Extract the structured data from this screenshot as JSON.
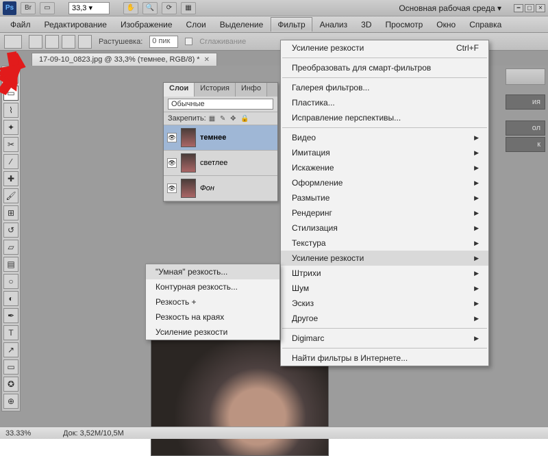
{
  "topbar": {
    "logo_text": "Ps",
    "zoom_value": "33,3 ▾",
    "workspace_label": "Основная рабочая среда ▾"
  },
  "menubar": {
    "items": [
      "Файл",
      "Редактирование",
      "Изображение",
      "Слои",
      "Выделение",
      "Фильтр",
      "Анализ",
      "3D",
      "Просмотр",
      "Окно",
      "Справка"
    ],
    "active_index": 5
  },
  "optbar": {
    "feather_label": "Растушевка:",
    "feather_value": "0 пик",
    "antialias_label": "Сглаживание"
  },
  "doc_tab": {
    "title": "17-09-10_0823.jpg @ 33,3% (темнее, RGB/8) *"
  },
  "layers": {
    "tabs": [
      "Слои",
      "История",
      "Инфо"
    ],
    "blend_label": "Обычные",
    "lock_label": "Закрепить:",
    "items": [
      {
        "name": "темнее",
        "bold": true
      },
      {
        "name": "светлее",
        "bold": false
      },
      {
        "name": "Фон",
        "italic": true
      }
    ]
  },
  "filter_menu": {
    "top": {
      "label": "Усиление резкости",
      "hotkey": "Ctrl+F"
    },
    "smart": "Преобразовать для смарт-фильтров",
    "gallery": "Галерея фильтров...",
    "liquify": "Пластика...",
    "vanish": "Исправление перспективы...",
    "groups": [
      "Видео",
      "Имитация",
      "Искажение",
      "Оформление",
      "Размытие",
      "Рендеринг",
      "Стилизация",
      "Текстура",
      "Усиление резкости",
      "Штрихи",
      "Шум",
      "Эскиз",
      "Другое"
    ],
    "hl_index": 8,
    "digimarc": "Digimarc",
    "online": "Найти фильтры в Интернете..."
  },
  "sharpen_menu": {
    "items": [
      "\"Умная\" резкость...",
      "Контурная резкость...",
      "Резкость +",
      "Резкость на краях",
      "Усиление резкости"
    ],
    "hl_index": 0
  },
  "right_dock": {
    "tabs": [
      "ия",
      "ол",
      "к"
    ]
  },
  "status": {
    "zoom": "33.33%",
    "doc": "Док: 3,52M/10,5M"
  }
}
